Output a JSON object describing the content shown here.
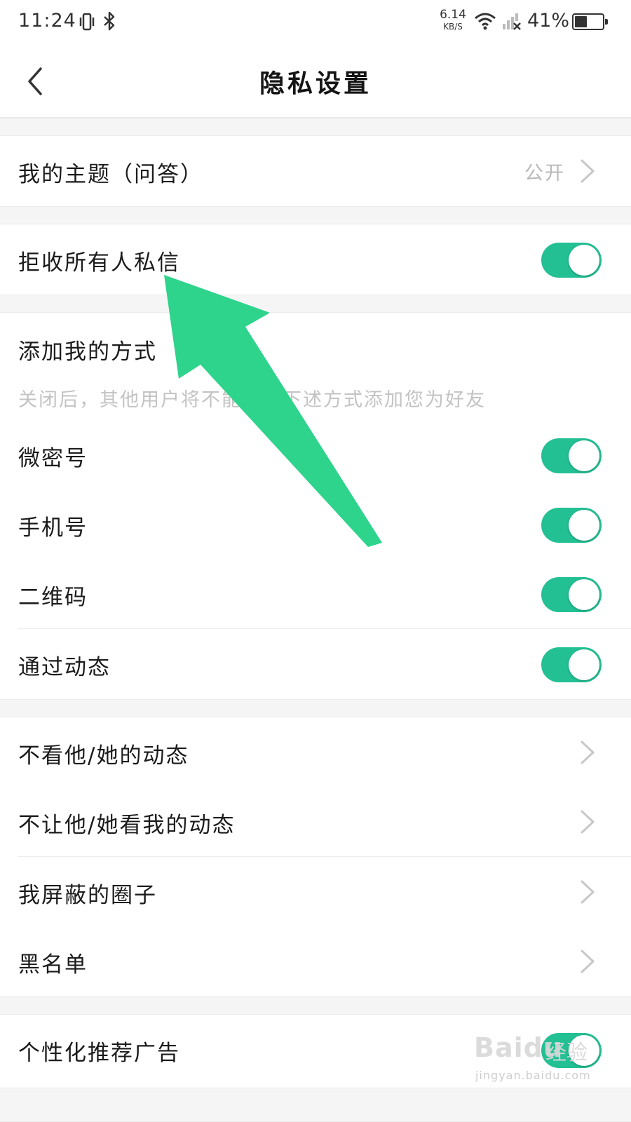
{
  "status_bar": {
    "time": "11:24",
    "net_speed_value": "6.14",
    "net_speed_unit": "KB/S",
    "battery_percent": "41%",
    "icons": [
      "vibrate-icon",
      "bluetooth-icon",
      "wifi-icon",
      "signal-off-icon",
      "battery-icon"
    ]
  },
  "header": {
    "title": "隐私设置",
    "back_icon": "back-chevron-icon"
  },
  "sections": {
    "theme": {
      "label": "我的主题（问答）",
      "value": "公开"
    },
    "reject_messages": {
      "label": "拒收所有人私信",
      "enabled": true
    },
    "add_methods": {
      "title": "添加我的方式",
      "hint": "关闭后，其他用户将不能通过下述方式添加您为好友",
      "items": [
        {
          "label": "微密号",
          "enabled": true
        },
        {
          "label": "手机号",
          "enabled": true
        },
        {
          "label": "二维码",
          "enabled": true
        },
        {
          "label": "通过动态",
          "enabled": true
        }
      ]
    },
    "nav_items": [
      {
        "label": "不看他/她的动态"
      },
      {
        "label": "不让他/她看我的动态"
      },
      {
        "label": "我屏蔽的圈子"
      },
      {
        "label": "黑名单"
      }
    ],
    "ads": {
      "label": "个性化推荐广告",
      "enabled": true
    }
  },
  "watermark": {
    "brand": "Baidu",
    "suffix": "经验",
    "url": "jingyan.baidu.com"
  },
  "colors": {
    "toggle_on": "#23c094",
    "annotation_arrow": "#2ed38c",
    "hint_text": "#c3c3c3"
  }
}
